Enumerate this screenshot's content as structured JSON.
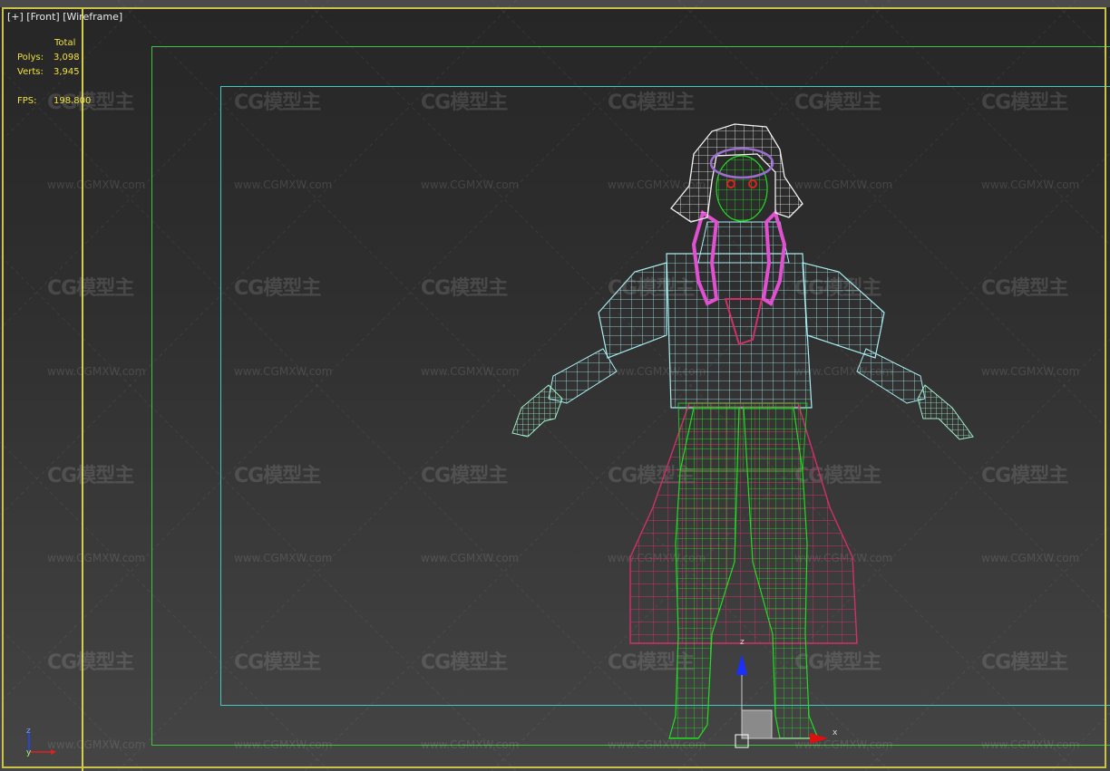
{
  "viewport": {
    "label": "[+] [Front] [Wireframe]",
    "stats": {
      "column_header": "Total",
      "polys_label": "Polys:",
      "polys_value": "3,098",
      "verts_label": "Verts:",
      "verts_value": "3,945",
      "fps_label": "FPS:",
      "fps_value": "198.800"
    },
    "gizmo": {
      "x_label": "x",
      "z_label": "z"
    },
    "tripod": {
      "z_label": "z",
      "y_label": "y"
    }
  },
  "watermark": {
    "logo_text": "CG模型主",
    "url_text": "www.CGMXW.com"
  },
  "colors": {
    "viewport_border": "#c9c34a",
    "render_frame": "#3ec43e",
    "safe_frame": "#3fc9c2",
    "stats_text": "#f0e040",
    "wire_white": "#f2f2f2",
    "wire_cyan": "#a8ecf0",
    "wire_green": "#22dd22",
    "wire_magenta": "#d0306a",
    "wire_pink": "#e050d0",
    "wire_mint": "#a0f0c8",
    "gizmo_blue": "#1a30ff",
    "gizmo_red": "#e01010"
  }
}
